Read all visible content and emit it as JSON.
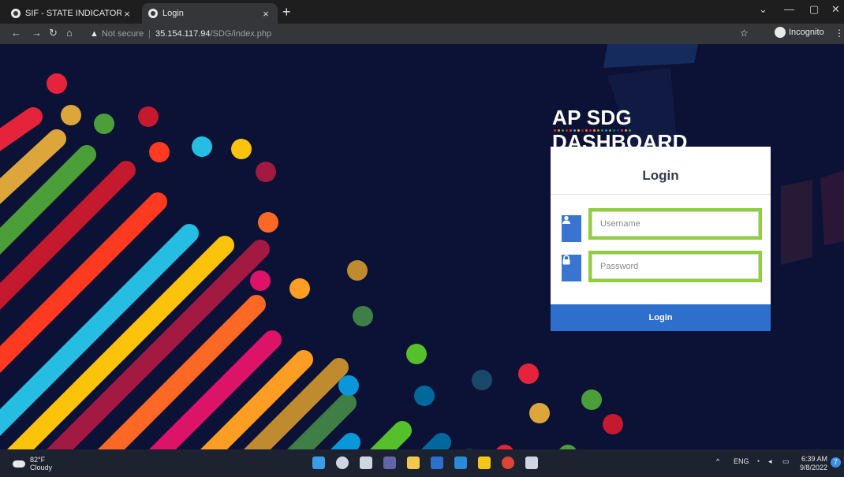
{
  "browser": {
    "tabs": [
      {
        "title": "SIF - STATE INDICATOR MONITO",
        "active": false
      },
      {
        "title": "Login",
        "active": true
      }
    ],
    "new_tab_label": "+",
    "address": {
      "security_label": "Not secure",
      "host": "35.154.117.94",
      "path": "/SDG/index.php"
    },
    "profile_label": "Incognito",
    "icons": [
      "back-icon",
      "forward-icon",
      "reload-icon",
      "home-icon",
      "warning-icon",
      "star-icon",
      "sidepanel-icon",
      "incognito-icon",
      "menu-icon"
    ]
  },
  "page": {
    "brand": "AP SDG DASHBOARD",
    "login": {
      "title": "Login",
      "username_placeholder": "Username",
      "password_placeholder": "Password",
      "submit_label": "Login"
    },
    "colors": {
      "background": "#0b1235",
      "accent": "#2f6fcc",
      "highlight_border": "#8fcf3b"
    }
  },
  "taskbar": {
    "weather": {
      "temp": "82°F",
      "condition": "Cloudy"
    },
    "tray": {
      "language": "ENG"
    },
    "clock": {
      "time": "6:39 AM",
      "date": "9/8/2022"
    },
    "notifications": "7"
  }
}
